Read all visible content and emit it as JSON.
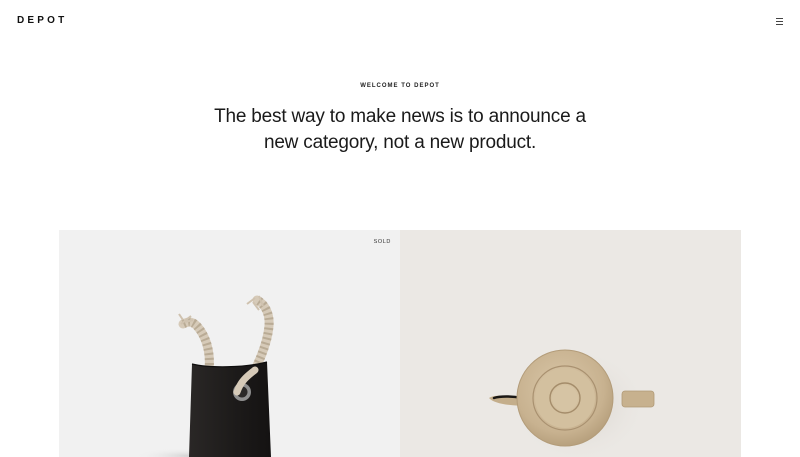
{
  "brand": {
    "logo_text": "DEPOT"
  },
  "header": {
    "menu_icon": "hamburger-menu-icon"
  },
  "hero": {
    "eyebrow": "WELCOME TO DEPOT",
    "headline": "The best way to make news is to announce a new category, not a new product."
  },
  "products": [
    {
      "image": "black-rope-handle-bag",
      "badge": "SOLD"
    },
    {
      "image": "ceramic-teapot-top-view",
      "badge": ""
    }
  ],
  "colors": {
    "text": "#1a1a1a",
    "card_left_bg": "#f1f1f1",
    "card_right_bg": "#ebe8e4",
    "bag": "#1f1d1c",
    "rope": "#d8cdbd",
    "teapot": "#cbb797"
  }
}
